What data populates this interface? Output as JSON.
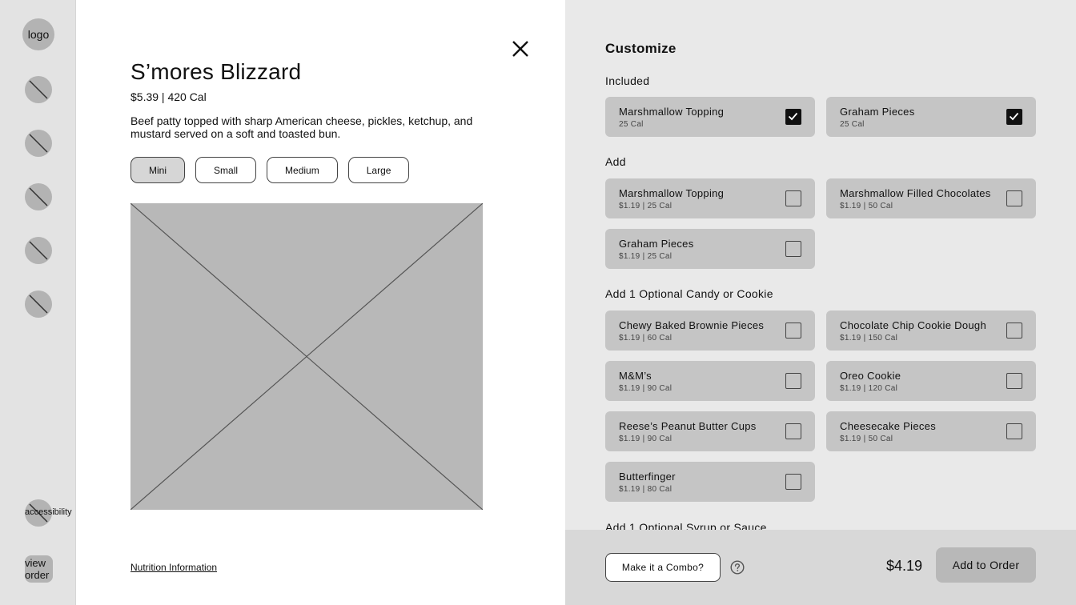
{
  "sidebar": {
    "logo_label": "logo",
    "nav_items": [
      {
        "icon": "placeholder-icon"
      },
      {
        "icon": "placeholder-icon"
      },
      {
        "icon": "placeholder-icon"
      },
      {
        "icon": "placeholder-icon"
      },
      {
        "icon": "placeholder-icon"
      }
    ],
    "accessibility_label": "accessibility",
    "view_order_label": "view\norder"
  },
  "product": {
    "title": "S’mores Blizzard",
    "price": "$5.39",
    "calories": "420 Cal",
    "price_cal": "$5.39 | 420 Cal",
    "description": "Beef patty topped with sharp American cheese, pickles, ketchup, and mustard served on a soft and toasted bun.",
    "sizes": [
      {
        "label": "Mini",
        "selected": true
      },
      {
        "label": "Small",
        "selected": false
      },
      {
        "label": "Medium",
        "selected": false
      },
      {
        "label": "Large",
        "selected": false
      }
    ],
    "nutrition_link": "Nutrition Information"
  },
  "customize": {
    "title": "Customize",
    "sections": {
      "included": {
        "label": "Included",
        "items": [
          {
            "name": "Marshmallow Topping",
            "sub": "25 Cal",
            "checked": true
          },
          {
            "name": "Graham Pieces",
            "sub": "25 Cal",
            "checked": true
          }
        ]
      },
      "add": {
        "label": "Add",
        "items": [
          {
            "name": "Marshmallow Topping",
            "sub": "$1.19 | 25 Cal",
            "checked": false
          },
          {
            "name": "Marshmallow Filled Chocolates",
            "sub": "$1.19 | 50 Cal",
            "checked": false
          },
          {
            "name": "Graham Pieces",
            "sub": "$1.19 | 25 Cal",
            "checked": false
          }
        ]
      },
      "candy": {
        "label": "Add 1 Optional Candy or Cookie",
        "items": [
          {
            "name": "Chewy Baked Brownie Pieces",
            "sub": "$1.19 | 60 Cal",
            "checked": false
          },
          {
            "name": "Chocolate Chip Cookie Dough",
            "sub": "$1.19 | 150 Cal",
            "checked": false
          },
          {
            "name": "M&M’s",
            "sub": "$1.19 | 90 Cal",
            "checked": false
          },
          {
            "name": "Oreo Cookie",
            "sub": "$1.19 | 120 Cal",
            "checked": false
          },
          {
            "name": "Reese’s Peanut Butter Cups",
            "sub": "$1.19 | 90 Cal",
            "checked": false
          },
          {
            "name": "Cheesecake Pieces",
            "sub": "$1.19 | 50 Cal",
            "checked": false
          },
          {
            "name": "Butterfinger",
            "sub": "$1.19 | 80 Cal",
            "checked": false
          }
        ]
      },
      "syrup": {
        "label": "Add 1 Optional Syrup or Sauce"
      }
    }
  },
  "footer": {
    "combo_label": "Make it a Combo?",
    "help_icon": "question-circle-icon",
    "total": "$4.19",
    "add_label": "Add to Order"
  }
}
